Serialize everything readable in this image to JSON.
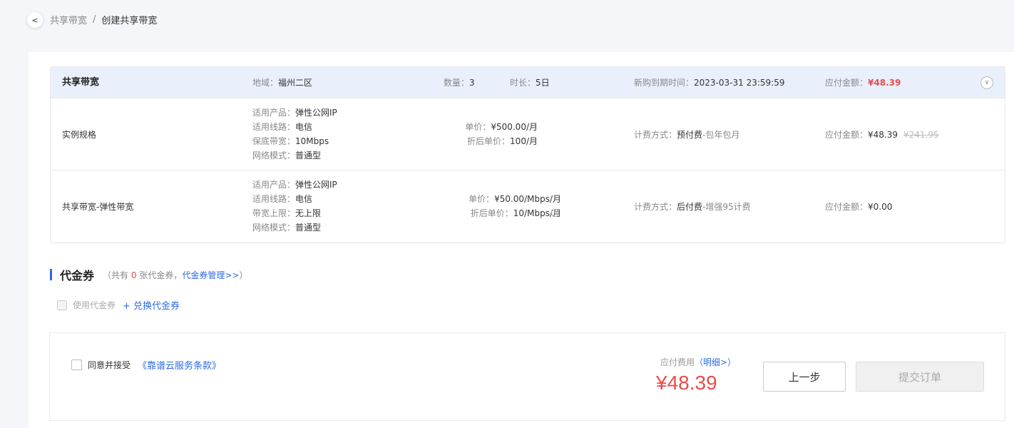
{
  "breadcrumb": {
    "back_icon": "chevron-left-icon",
    "parent": "共享带宽",
    "separator": "/",
    "current": "创建共享带宽"
  },
  "order": {
    "header": {
      "title": "共享带宽",
      "region_label": "地域：",
      "region": "福州二区",
      "quantity_label": "数量：",
      "quantity": "3",
      "duration_label": "时长：",
      "duration": "5日",
      "expire_label": "新购到期时间：",
      "expire": "2023-03-31 23:59:59",
      "amount_label": "应付金额：",
      "amount": "¥48.39",
      "collapse_icon": "chevron-down-icon"
    },
    "rows": [
      {
        "name": "实例规格",
        "specs": [
          {
            "label": "适用产品：",
            "value": "弹性公网IP"
          },
          {
            "label": "适用线路：",
            "value": "电信"
          },
          {
            "label": "保底带宽：",
            "value": "10Mbps"
          },
          {
            "label": "网络模式：",
            "value": "普通型"
          }
        ],
        "unit_price_label": "单价：",
        "unit_price": "¥500.00/月",
        "discount_price_label": "折后单价：",
        "discount_price": "100/月",
        "billing_label": "计费方式：",
        "billing_main": "预付费",
        "billing_sub": "-包年包月",
        "amount_label": "应付金额：",
        "amount": "¥48.39",
        "original_amount": "¥241.95"
      },
      {
        "name": "共享带宽-弹性带宽",
        "specs": [
          {
            "label": "适用产品：",
            "value": "弹性公网IP"
          },
          {
            "label": "适用线路：",
            "value": "电信"
          },
          {
            "label": "带宽上限：",
            "value": "无上限"
          },
          {
            "label": "网络模式：",
            "value": "普通型"
          }
        ],
        "unit_price_label": "单价：",
        "unit_price": "¥50.00/Mbps/月",
        "discount_price_label": "折后单价：",
        "discount_price": "10/Mbps/月",
        "billing_label": "计费方式：",
        "billing_main": "后付费",
        "billing_sub": "-增强95计费",
        "amount_label": "应付金额：",
        "amount": "¥0.00"
      }
    ]
  },
  "voucher": {
    "title": "代金券",
    "note_prefix": "（共有",
    "count": "0",
    "note_mid": "张代金券，",
    "manage_link": "代金券管理>>",
    "note_suffix": "）",
    "use_label": "使用代金券",
    "exchange_link": "+ 兑换代金券"
  },
  "footer": {
    "agree_text": "同意并接受",
    "terms_link": "《靠谱云服务条款》",
    "fee_label": "应付费用",
    "detail_link": "（明细>）",
    "fee_value": "¥48.39",
    "prev_button": "上一步",
    "submit_button": "提交订单"
  },
  "colors": {
    "accent": "#2c6be0",
    "price": "#e94c4c",
    "header_bg": "#eaf0fb"
  }
}
